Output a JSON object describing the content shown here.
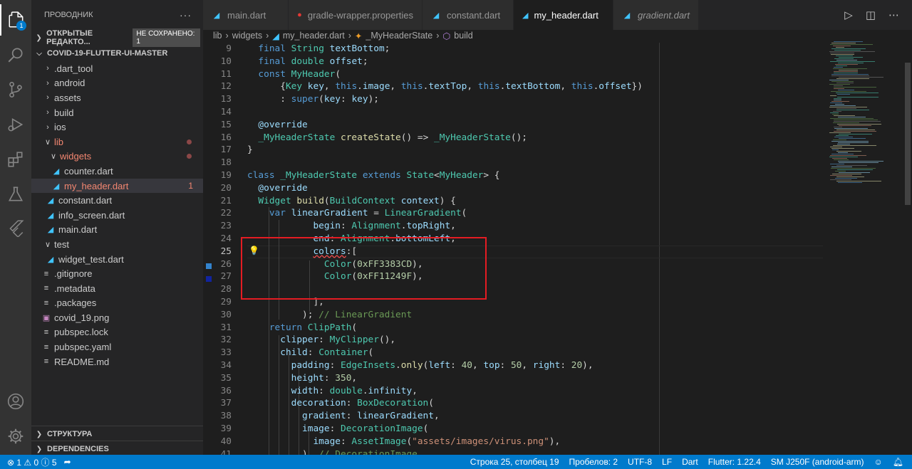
{
  "explorer": {
    "title": "ПРОВОДНИК",
    "more": "···",
    "open_editors": "ОТКРЫТЫЕ РЕДАКТО...",
    "unsaved_badge": "НЕ СОХРАНЕНО: 1",
    "project": "COVID-19-FLUTTER-UI-MASTER",
    "tree": [
      {
        "label": ".dart_tool",
        "kind": "folder"
      },
      {
        "label": "android",
        "kind": "folder"
      },
      {
        "label": "assets",
        "kind": "folder"
      },
      {
        "label": "build",
        "kind": "folder"
      },
      {
        "label": "ios",
        "kind": "folder"
      },
      {
        "label": "lib",
        "kind": "folder-open"
      },
      {
        "label": "widgets",
        "kind": "folder-open"
      },
      {
        "label": "counter.dart",
        "kind": "dart"
      },
      {
        "label": "my_header.dart",
        "kind": "dart"
      },
      {
        "label": "constant.dart",
        "kind": "dart"
      },
      {
        "label": "info_screen.dart",
        "kind": "dart"
      },
      {
        "label": "main.dart",
        "kind": "dart"
      },
      {
        "label": "test",
        "kind": "folder-open"
      },
      {
        "label": "widget_test.dart",
        "kind": "dart"
      },
      {
        "label": ".gitignore",
        "kind": "text"
      },
      {
        "label": ".metadata",
        "kind": "text"
      },
      {
        "label": ".packages",
        "kind": "text"
      },
      {
        "label": "covid_19.png",
        "kind": "image"
      },
      {
        "label": "pubspec.lock",
        "kind": "text"
      },
      {
        "label": "pubspec.yaml",
        "kind": "text"
      },
      {
        "label": "README.md",
        "kind": "text"
      }
    ],
    "error_count": "1",
    "structure": "СТРУКТУРА",
    "dependencies": "DEPENDENCIES"
  },
  "tabs": [
    {
      "label": "main.dart"
    },
    {
      "label": "gradle-wrapper.properties"
    },
    {
      "label": "constant.dart"
    },
    {
      "label": "my_header.dart"
    },
    {
      "label": "gradient.dart"
    }
  ],
  "breadcrumb": [
    "lib",
    "widgets",
    "my_header.dart",
    "_MyHeaderState",
    "build"
  ],
  "status": {
    "errors": "1",
    "warnings": "0",
    "info": "5",
    "position": "Строка 25, столбец 19",
    "spaces": "Пробелов: 2",
    "encoding": "UTF-8",
    "eol": "LF",
    "language": "Dart",
    "flutter": "Flutter: 1.22.4",
    "device": "SM J250F (android-arm)"
  },
  "line_numbers": [
    "9",
    "10",
    "11",
    "12",
    "13",
    "14",
    "15",
    "16",
    "17",
    "18",
    "19",
    "20",
    "21",
    "22",
    "23",
    "24",
    "25",
    "26",
    "27",
    "28",
    "29",
    "30",
    "31",
    "32",
    "33",
    "34",
    "35",
    "36",
    "37",
    "38",
    "39",
    "40",
    "41"
  ],
  "colors": {
    "accent": "#007acc",
    "highlight_box": "#e51c23",
    "swatch1": "#3383CD",
    "swatch2": "#11249F"
  }
}
